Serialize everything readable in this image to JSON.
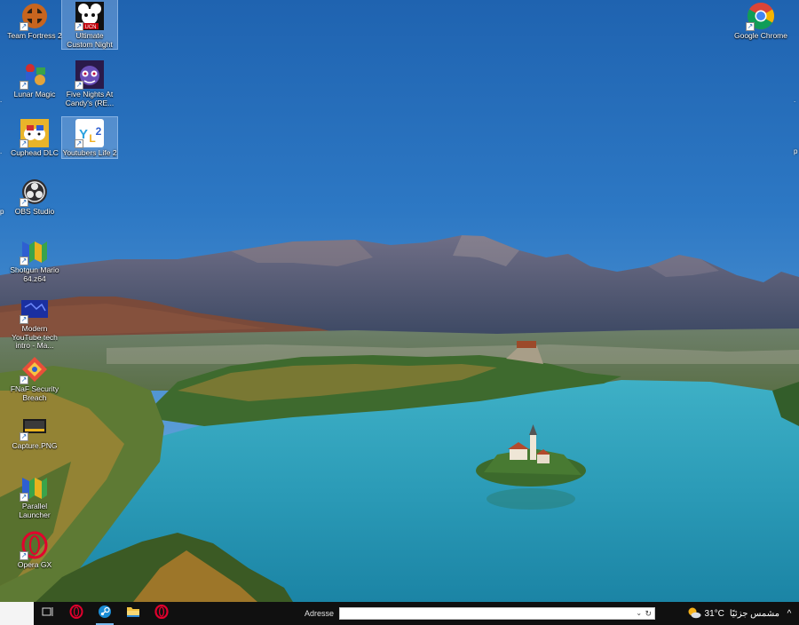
{
  "desktop_icons": [
    {
      "id": "tf2",
      "label": "Team Fortress 2",
      "col": 0,
      "row": 0,
      "icon": "team-fortress-2-icon",
      "selected": false
    },
    {
      "id": "ucn",
      "label": "Ultimate Custom Night",
      "col": 1,
      "row": 0,
      "icon": "ultimate-custom-night-icon",
      "selected": true
    },
    {
      "id": "lunar",
      "label": "Lunar Magic",
      "col": 0,
      "row": 1,
      "icon": "lunar-magic-icon",
      "selected": false
    },
    {
      "id": "fnac",
      "label": "Five Nights At Candy's (RE...",
      "col": 1,
      "row": 1,
      "icon": "five-nights-at-candys-icon",
      "selected": false
    },
    {
      "id": "cuphead",
      "label": "Cuphead DLC",
      "col": 0,
      "row": 2,
      "icon": "cuphead-icon",
      "selected": false
    },
    {
      "id": "yl2",
      "label": "Youtubers Life 2",
      "col": 1,
      "row": 2,
      "icon": "youtubers-life-2-icon",
      "selected": true
    },
    {
      "id": "obs",
      "label": "OBS Studio",
      "col": 0,
      "row": 3,
      "icon": "obs-studio-icon",
      "selected": false
    },
    {
      "id": "shotgun",
      "label": "Shotgun Mario 64.z64",
      "col": 0,
      "row": 4,
      "icon": "n64-icon",
      "selected": false
    },
    {
      "id": "modernyt",
      "label": "Modern YouTube tech intro - Ma...",
      "col": 0,
      "row": 5,
      "icon": "video-thumbnail-icon",
      "selected": false
    },
    {
      "id": "fnaf",
      "label": "FNaF Security Breach",
      "col": 0,
      "row": 6,
      "icon": "fnaf-security-breach-icon",
      "selected": false
    },
    {
      "id": "capture",
      "label": "Capture.PNG",
      "col": 0,
      "row": 7,
      "icon": "image-file-icon",
      "selected": false
    },
    {
      "id": "parallel",
      "label": "Parallel Launcher",
      "col": 0,
      "row": 8,
      "icon": "n64-icon",
      "selected": false
    },
    {
      "id": "operagx",
      "label": "Opera GX",
      "col": 0,
      "row": 9,
      "icon": "opera-gx-icon",
      "selected": false
    }
  ],
  "chrome_icon": {
    "label": "Google Chrome",
    "icon": "chrome-icon"
  },
  "taskbar": {
    "apps": [
      {
        "name": "task-view-button",
        "icon": "task-view-icon",
        "active": false
      },
      {
        "name": "taskbar-opera-gx",
        "icon": "opera-gx-icon",
        "active": false
      },
      {
        "name": "taskbar-steam",
        "icon": "steam-icon",
        "active": true
      },
      {
        "name": "taskbar-file-explorer",
        "icon": "folder-icon",
        "active": false
      },
      {
        "name": "taskbar-opera",
        "icon": "opera-icon",
        "active": false
      }
    ],
    "address_label": "Adresse",
    "address_value": "",
    "weather_temp": "31°C",
    "weather_desc": "مشمس جزئيًا",
    "tray_chevron": "^"
  },
  "colors": {
    "taskbar_bg": "#101010",
    "opera_red": "#e3002d",
    "steam_blue": "#1b8dd6",
    "accent": "#76b9ed"
  }
}
